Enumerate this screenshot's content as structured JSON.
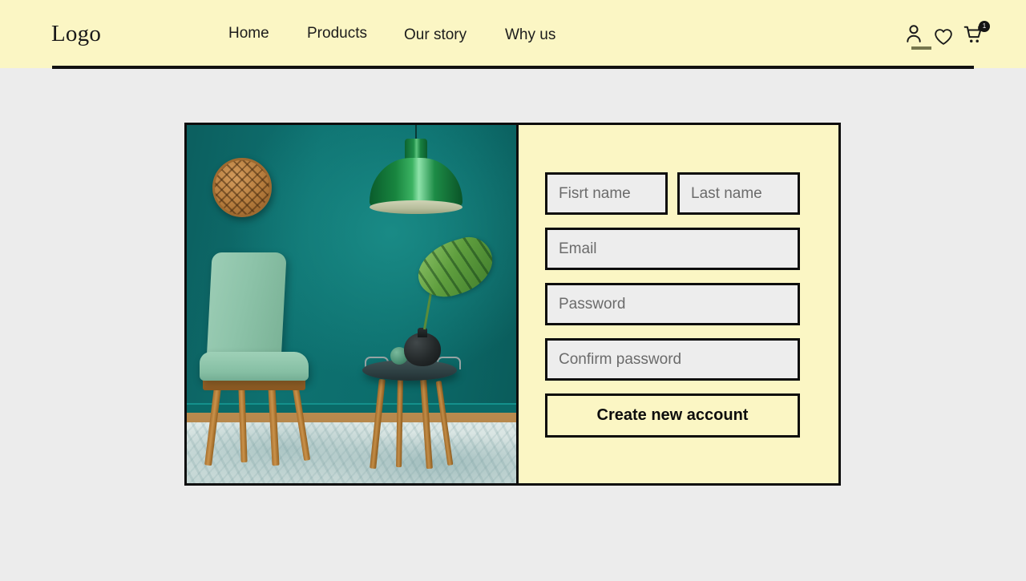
{
  "page": {
    "background_color": "#ececec"
  },
  "header": {
    "background_color": "#fbf6c4",
    "logo": "Logo",
    "nav_items": [
      {
        "label": "Home"
      },
      {
        "label": "Products"
      },
      {
        "label": "Our story"
      },
      {
        "label": "Why us"
      }
    ],
    "icons": {
      "account": "user-icon",
      "wishlist": "heart-icon",
      "cart": "shopping-cart-icon",
      "cart_badge_count": "1"
    }
  },
  "card": {
    "image": {
      "alt": "interior-photo-teal-room-with-mint-chair-green-pendant-lamp-side-table",
      "wall_color": "#0d6e6e",
      "lamp_color": "#18853f",
      "chair_color": "#8dc3a9"
    },
    "form": {
      "background_color": "#fbf6c4",
      "fields": [
        {
          "name": "first-name",
          "placeholder": "Fisrt name",
          "value": ""
        },
        {
          "name": "last-name",
          "placeholder": "Last name",
          "value": ""
        },
        {
          "name": "email",
          "placeholder": "Email",
          "value": ""
        },
        {
          "name": "password",
          "placeholder": "Password",
          "value": ""
        },
        {
          "name": "confirm-password",
          "placeholder": "Confirm password",
          "value": ""
        }
      ],
      "submit_label": "Create new account"
    }
  }
}
